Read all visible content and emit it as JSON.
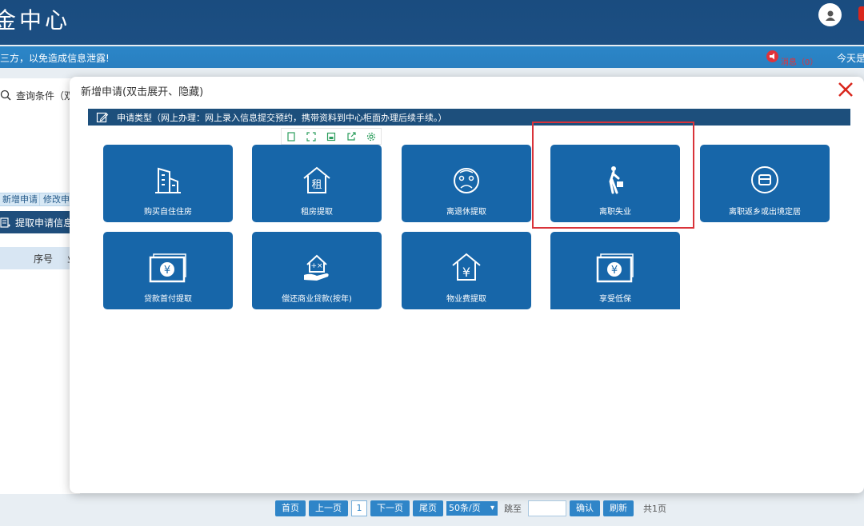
{
  "header": {
    "logo_text": "金中心",
    "notice": "三方，以免造成信息泄露!",
    "message_label": "消息（0）",
    "today_label": "今天是"
  },
  "left_panel": {
    "query_label": "查询条件（双击",
    "new_button": "新增申请",
    "edit_button": "修改申请",
    "list_title": "提取申请信息",
    "table_headers": [
      "序号",
      "业"
    ]
  },
  "modal": {
    "title": "新增申请(双击展开、隐藏)",
    "type_bar": "申请类型（网上办理：网上录入信息提交预约，携带资料到中心柜面办理后续手续。）",
    "tiles": [
      {
        "label": "购买自住住房",
        "icon": "building-icon"
      },
      {
        "label": "租房提取",
        "icon": "rent-house-icon"
      },
      {
        "label": "离退休提取",
        "icon": "elder-face-icon"
      },
      {
        "label": "离职失业",
        "icon": "walking-person-icon"
      },
      {
        "label": "离职返乡或出境定居",
        "icon": "box-icon"
      },
      {
        "label": "贷款首付提取",
        "icon": "yuan-note-icon"
      },
      {
        "label": "偿还商业贷款(按年)",
        "icon": "hand-house-icon"
      },
      {
        "label": "物业费提取",
        "icon": "yuan-house-icon"
      },
      {
        "label": "享受低保",
        "icon": "yuan-note-icon"
      }
    ]
  },
  "pager": {
    "first": "首页",
    "prev": "上一页",
    "current": "1",
    "next": "下一页",
    "last": "尾页",
    "page_size": "50条/页",
    "jump_label": "跳至",
    "confirm": "确认",
    "refresh": "刷新",
    "total": "共1页"
  }
}
